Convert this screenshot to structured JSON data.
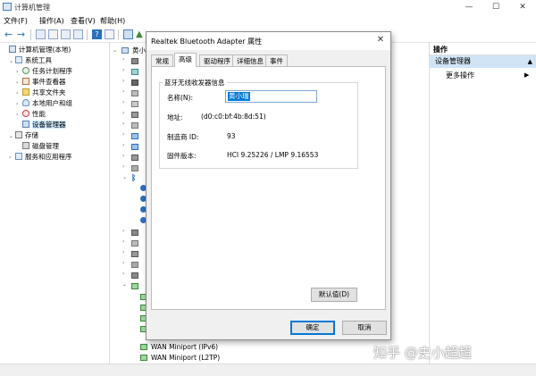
{
  "window": {
    "title": "计算机管理",
    "controls": [
      "—",
      "☐",
      "✕"
    ]
  },
  "menu": [
    "文件(F)",
    "操作(A)",
    "查看(V)",
    "帮助(H)"
  ],
  "tree": [
    {
      "label": "计算机管理(本地)",
      "indent": 0,
      "exp": "",
      "icon": "computer-icon",
      "color": "#5a7fb0"
    },
    {
      "label": "系统工具",
      "indent": 1,
      "exp": "⌄",
      "icon": "tools-icon",
      "color": "#6a8fc0"
    },
    {
      "label": "任务计划程序",
      "indent": 2,
      "exp": "›",
      "icon": "clock-icon",
      "color": "#5b8a5b"
    },
    {
      "label": "事件查看器",
      "indent": 2,
      "exp": "›",
      "icon": "event-icon",
      "color": "#b07040"
    },
    {
      "label": "共享文件夹",
      "indent": 2,
      "exp": "›",
      "icon": "folder-icon",
      "color": "#d9b44a"
    },
    {
      "label": "本地用户和组",
      "indent": 2,
      "exp": "›",
      "icon": "users-icon",
      "color": "#6a8fc0"
    },
    {
      "label": "性能",
      "indent": 2,
      "exp": "›",
      "icon": "performance-icon",
      "color": "#c04040"
    },
    {
      "label": "设备管理器",
      "indent": 2,
      "exp": "",
      "icon": "device-manager-icon",
      "color": "#5a7fb0",
      "selected": true
    },
    {
      "label": "存储",
      "indent": 1,
      "exp": "⌄",
      "icon": "storage-icon",
      "color": "#7a7a7a"
    },
    {
      "label": "磁盘管理",
      "indent": 2,
      "exp": "",
      "icon": "disk-icon",
      "color": "#7a7a7a"
    },
    {
      "label": "服务和应用程序",
      "indent": 1,
      "exp": "›",
      "icon": "services-icon",
      "color": "#6a8fc0"
    }
  ],
  "device_list": {
    "top_label": "黄小",
    "wan_items": [
      "WAN Miniport (IPv6)",
      "WAN Miniport (L2TP)"
    ]
  },
  "actions": {
    "header": "操作",
    "selected": "设备管理器",
    "more": "更多操作"
  },
  "dialog": {
    "title": "Realtek Bluetooth Adapter 属性",
    "tabs": [
      "常规",
      "高级",
      "驱动程序",
      "详细信息",
      "事件"
    ],
    "active_tab": 1,
    "group_title": "蓝牙无线收发器信息",
    "name_label": "名称(N):",
    "name_value": "黄小瑞",
    "address_label": "地址:",
    "address_value": "(d0:c0:bf:4b:8d:51)",
    "manufacturer_label": "制造商 ID:",
    "manufacturer_value": "93",
    "firmware_label": "固件版本:",
    "firmware_value": "HCI 9.25226  /  LMP 9.16553",
    "default_button": "默认值(D)",
    "ok_button": "确定",
    "cancel_button": "取消"
  },
  "watermark": "知乎 @史小超超"
}
